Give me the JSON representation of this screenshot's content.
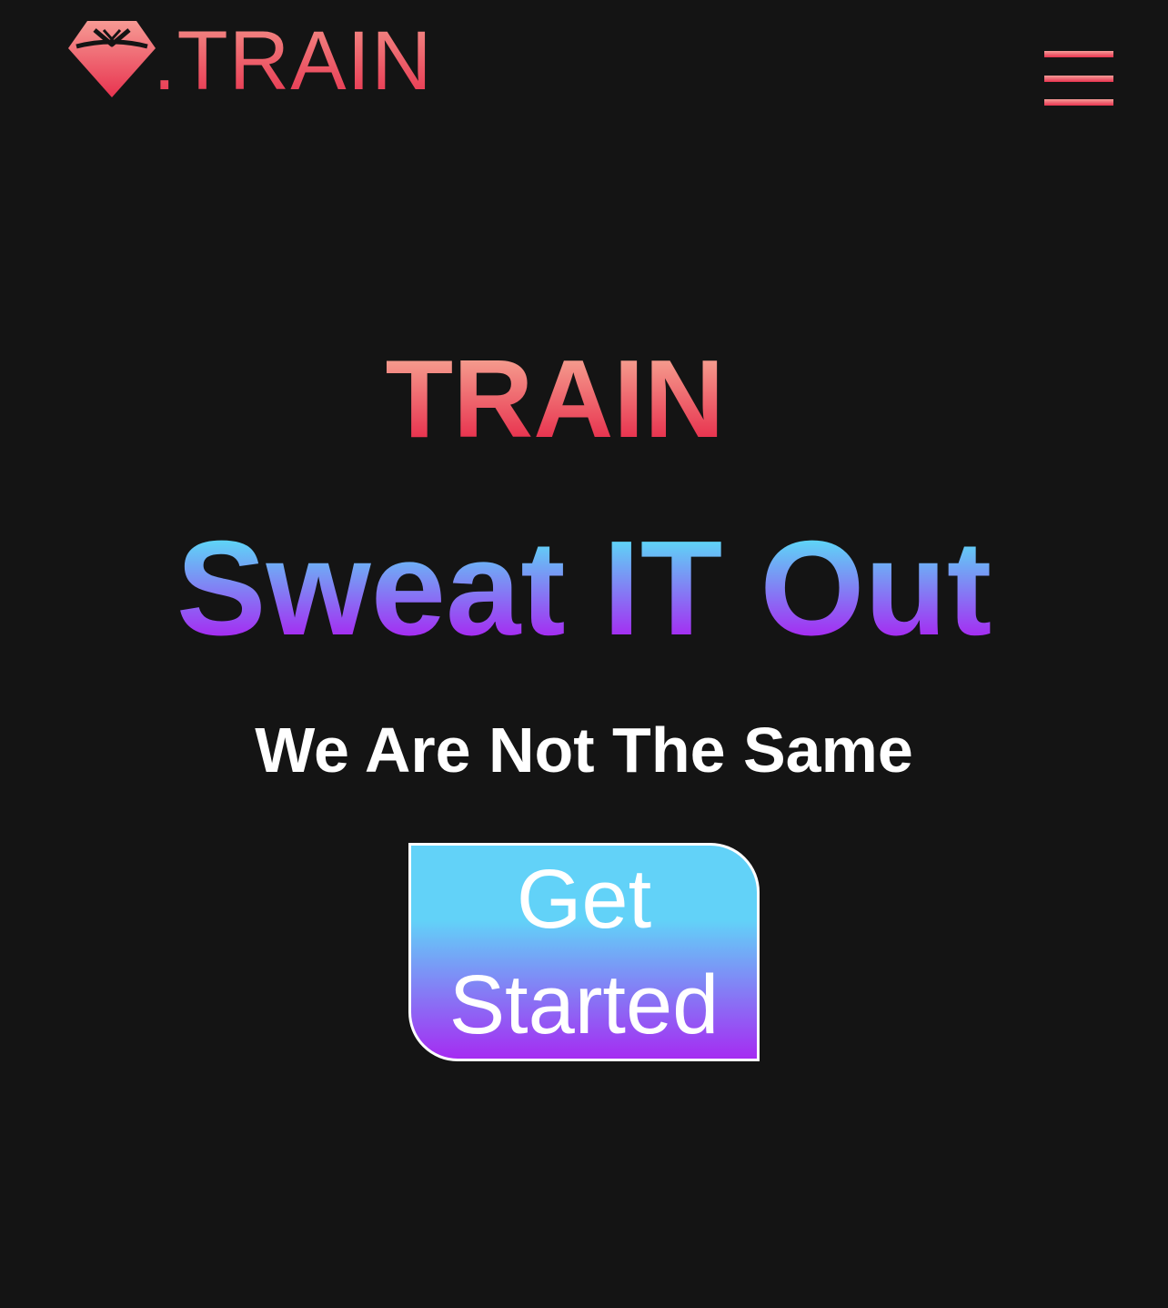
{
  "header": {
    "logo_text": ".TRAIN",
    "logo_icon": "diamond-icon",
    "menu_icon": "hamburger-menu-icon"
  },
  "hero": {
    "brand": "TRAIN",
    "headline": "Sweat IT Out",
    "tagline": "We Are Not The Same",
    "cta_label": "Get Started"
  },
  "colors": {
    "background": "#141414",
    "brand_gradient_top": "#f59c8e",
    "brand_gradient_bottom": "#e8334f",
    "headline_gradient_top": "#5fd3f6",
    "headline_gradient_bottom": "#a52cf2",
    "tagline": "#ffffff",
    "cta_border": "#ffffff"
  }
}
